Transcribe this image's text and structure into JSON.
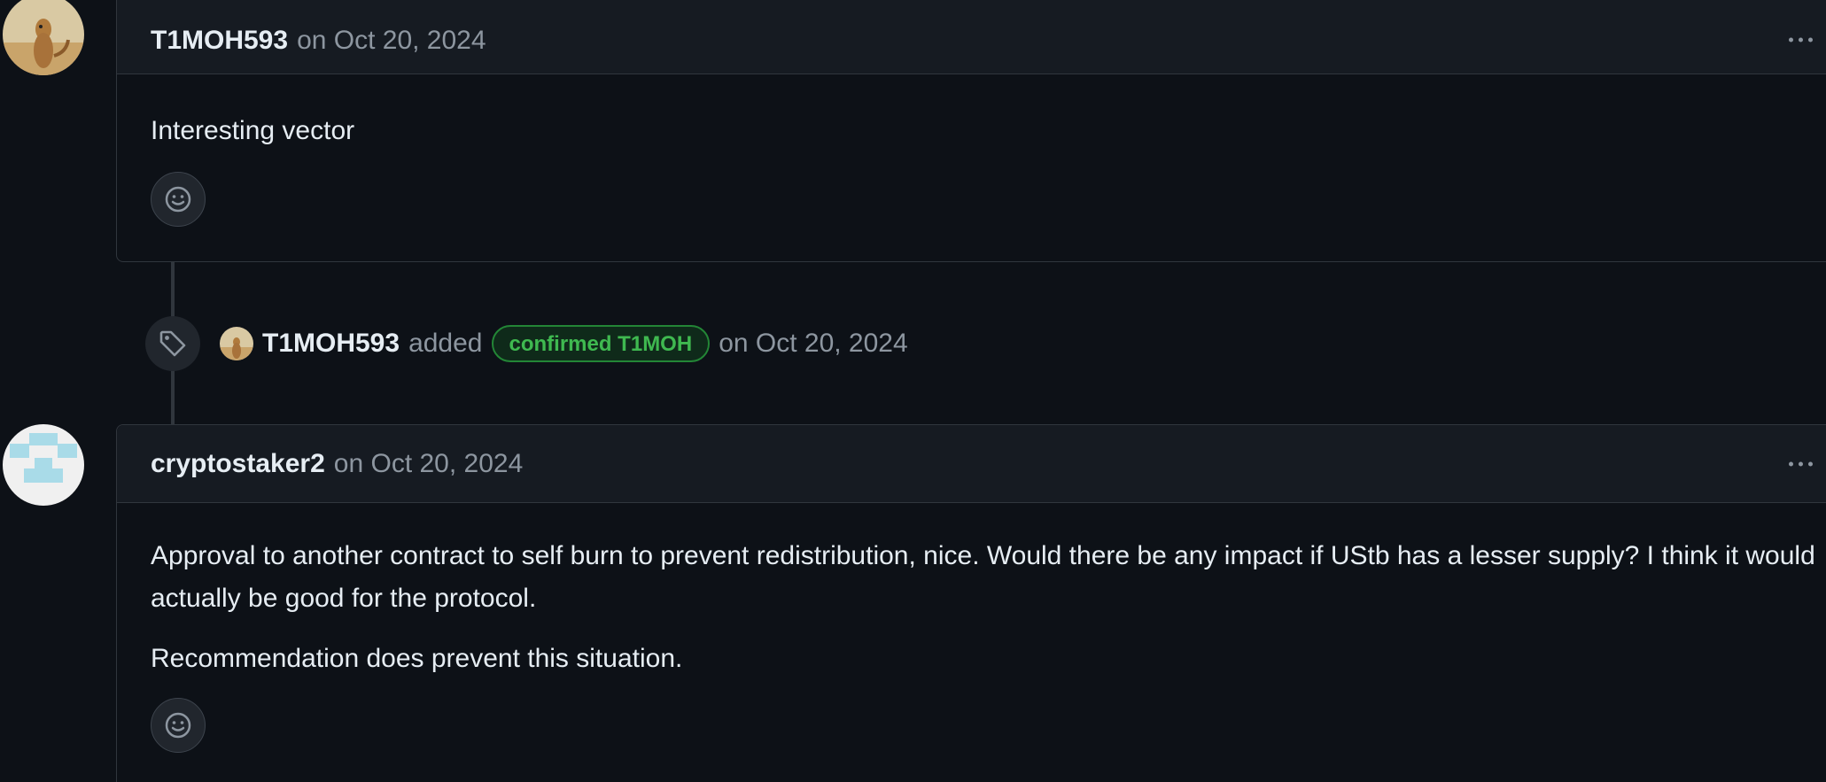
{
  "comments": [
    {
      "author": "T1MOH593",
      "date": "on Oct 20, 2024",
      "body": [
        "Interesting vector"
      ]
    },
    {
      "author": "cryptostaker2",
      "date": "on Oct 20, 2024",
      "body": [
        "Approval to another contract to self burn to prevent redistribution, nice. Would there be any impact if UStb has a lesser supply? I think it would actually be good for the protocol.",
        "Recommendation does prevent this situation."
      ]
    }
  ],
  "event": {
    "author": "T1MOH593",
    "action": "added",
    "label": "confirmed T1MOH",
    "date": "on Oct 20, 2024",
    "icon": "tag-icon"
  },
  "icons": {
    "menu": "kebab-horizontal-icon",
    "reaction": "smiley-icon"
  },
  "colors": {
    "background": "#0d1117",
    "header": "#161b22",
    "border": "#30363d",
    "label_green": "#3fb950",
    "muted": "#8d96a0"
  }
}
